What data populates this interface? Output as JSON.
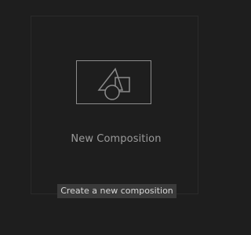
{
  "composition": {
    "label": "New Composition",
    "icon": "shapes-icon",
    "tooltip": "Create a new composition"
  },
  "colors": {
    "background": "#1e1e1e",
    "icon_stroke": "#8c8c8c",
    "label_text": "#9a9a9a",
    "tooltip_bg": "#3a3a3a",
    "tooltip_text": "#d8d8d8"
  }
}
